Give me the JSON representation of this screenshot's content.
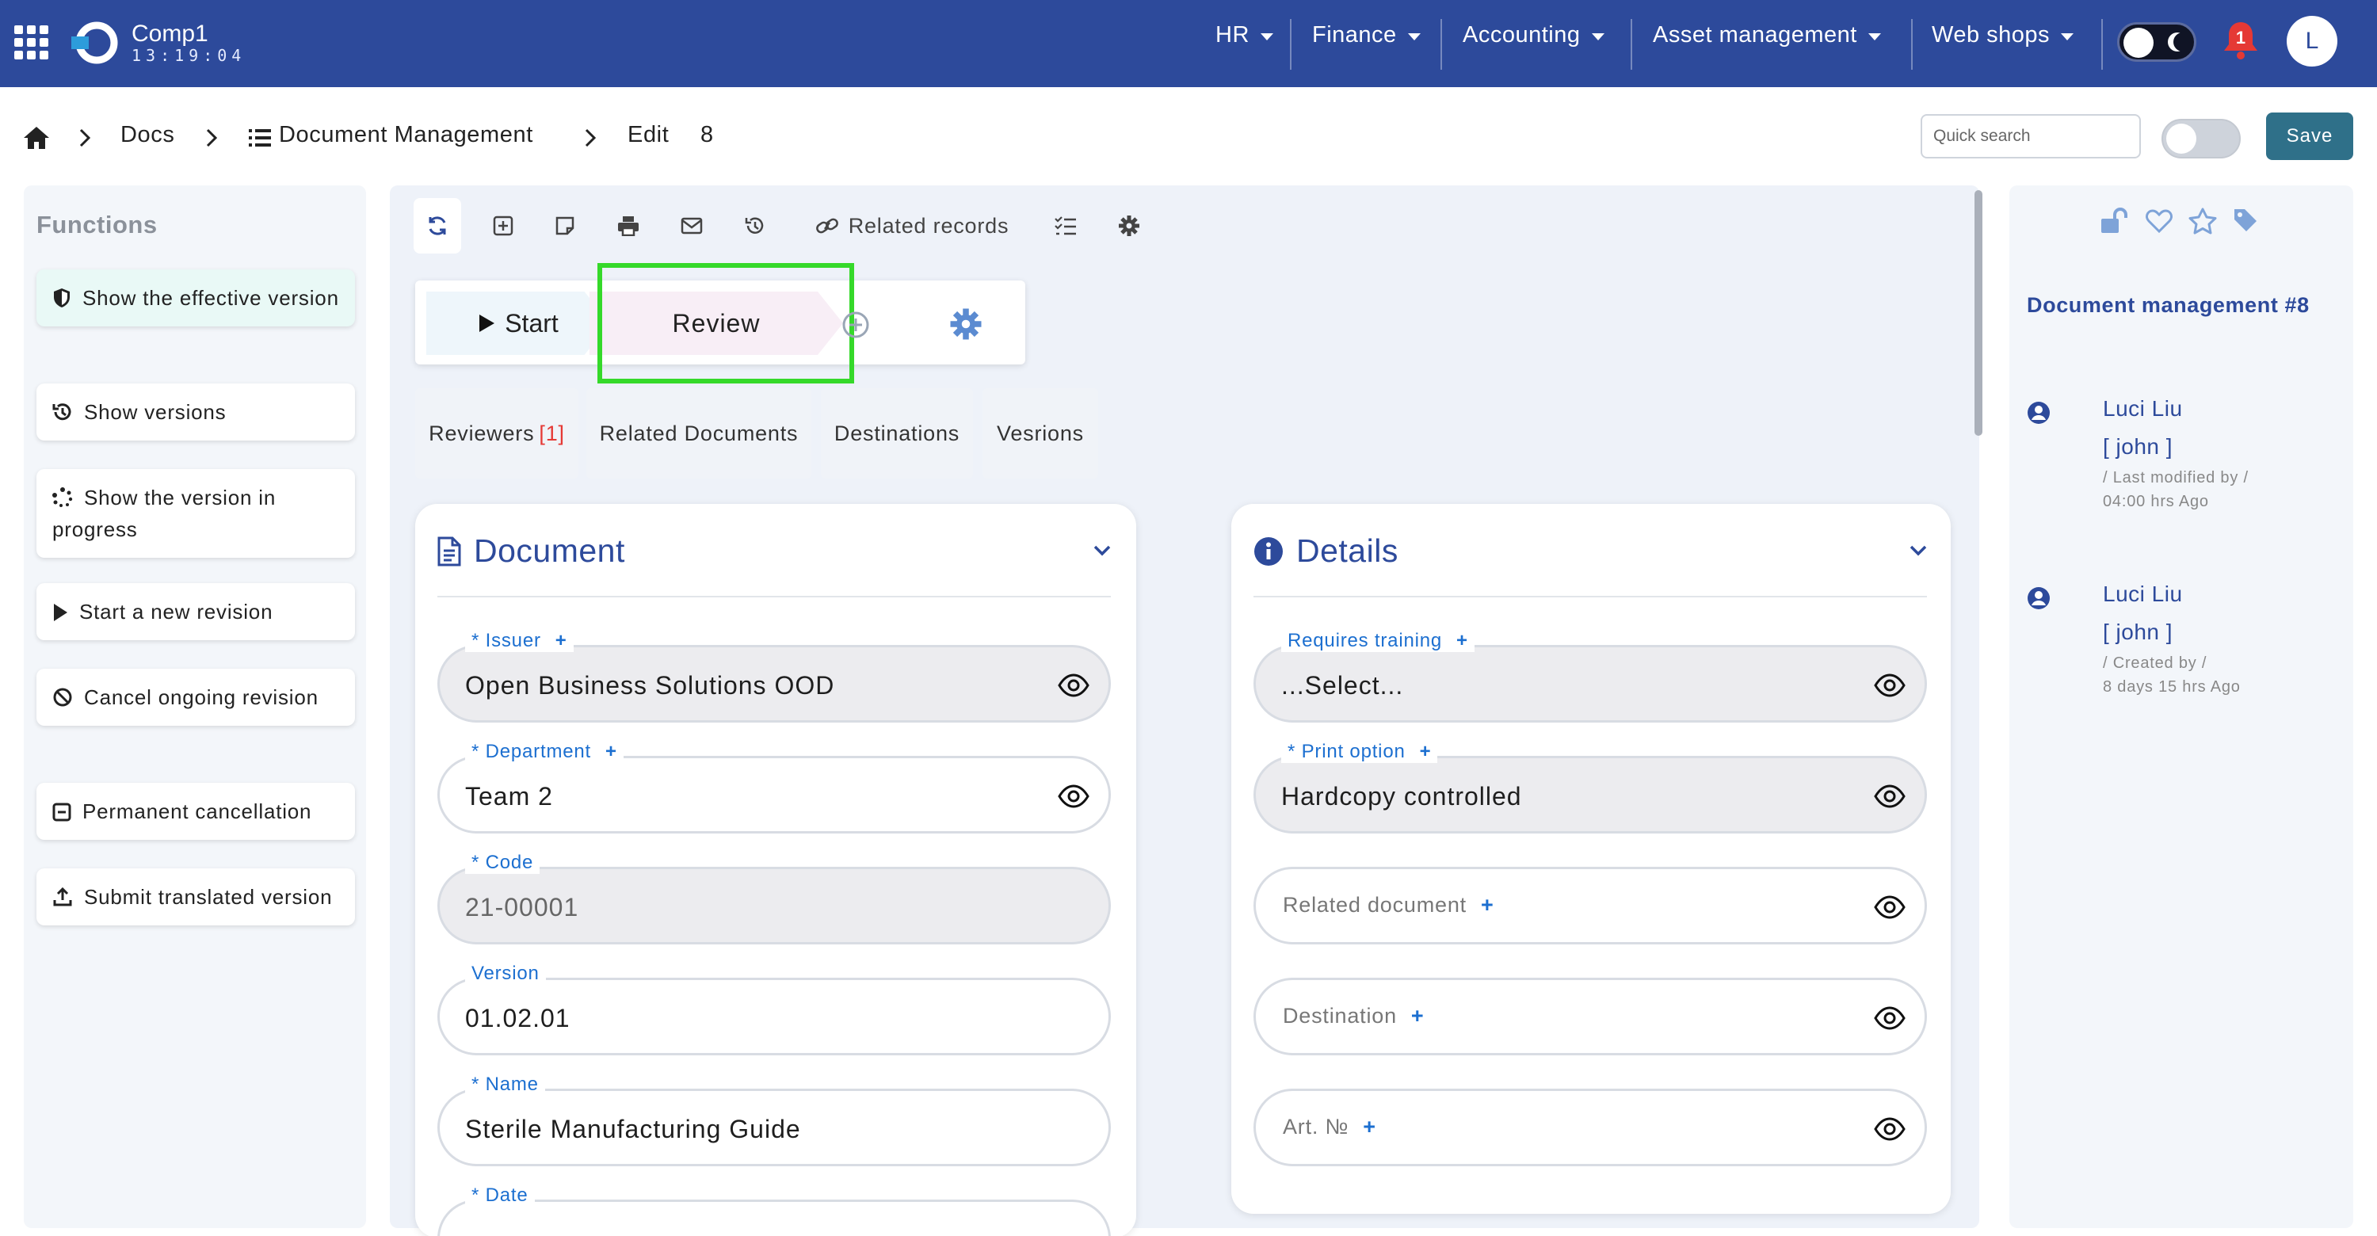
{
  "app": {
    "name": "Comp1",
    "clock": "13:19:04"
  },
  "top_nav": {
    "menus": [
      {
        "label": "HR"
      },
      {
        "label": "Finance"
      },
      {
        "label": "Accounting"
      },
      {
        "label": "Asset management"
      },
      {
        "label": "Web shops"
      }
    ],
    "notifications_count": "1",
    "avatar_initial": "L",
    "colors": {
      "bar": "#2d4a9b",
      "notification": "#e53935"
    }
  },
  "breadcrumb": {
    "docs": "Docs",
    "module": "Document Management",
    "action": "Edit",
    "record_id": "8"
  },
  "header_actions": {
    "search_placeholder": "Quick search",
    "save_label": "Save"
  },
  "functions": {
    "title": "Functions",
    "items": [
      {
        "label": "Show the effective version",
        "icon": "shield-icon"
      },
      {
        "label": "Show versions",
        "icon": "history-icon"
      },
      {
        "label": "Show the version in progress",
        "icon": "spinner-icon"
      },
      {
        "label": "Start a new revision",
        "icon": "play-icon"
      },
      {
        "label": "Cancel ongoing revision",
        "icon": "ban-icon"
      },
      {
        "label": "Permanent cancellation",
        "icon": "minus-square-icon"
      },
      {
        "label": "Submit translated version",
        "icon": "upload-icon"
      }
    ]
  },
  "toolbar": {
    "related_records": "Related records"
  },
  "workflow": {
    "start": "Start",
    "review": "Review"
  },
  "tabs": [
    {
      "label": "Reviewers",
      "count": "[1]"
    },
    {
      "label": "Related Documents"
    },
    {
      "label": "Destinations"
    },
    {
      "label": "Vesrions"
    }
  ],
  "document_panel": {
    "title": "Document",
    "fields": {
      "issuer": {
        "label": "* Issuer",
        "value": "Open Business Solutions OOD"
      },
      "department": {
        "label": "* Department",
        "value": "Team 2"
      },
      "code": {
        "label": "* Code",
        "value": "21-00001"
      },
      "version": {
        "label": "Version",
        "value": "01.02.01"
      },
      "name": {
        "label": "* Name",
        "value": "Sterile Manufacturing Guide"
      },
      "date": {
        "label": "* Date"
      }
    }
  },
  "details_panel": {
    "title": "Details",
    "fields": {
      "requires_training": {
        "label": "Requires training",
        "value": "...Select..."
      },
      "print_option": {
        "label": "* Print option",
        "value": "Hardcopy controlled"
      },
      "related_document": {
        "label": "Related document"
      },
      "destination": {
        "label": "Destination"
      },
      "art_no": {
        "label": "Art. №"
      }
    }
  },
  "right_panel": {
    "title": "Document management #8",
    "activity": [
      {
        "name": "Luci Liu",
        "user": "[ john ]",
        "action": "/ Last modified by /",
        "time": "04:00 hrs Ago"
      },
      {
        "name": "Luci Liu",
        "user": "[ john ]",
        "action": "/ Created by /",
        "time": "8 days 15 hrs Ago"
      }
    ]
  }
}
